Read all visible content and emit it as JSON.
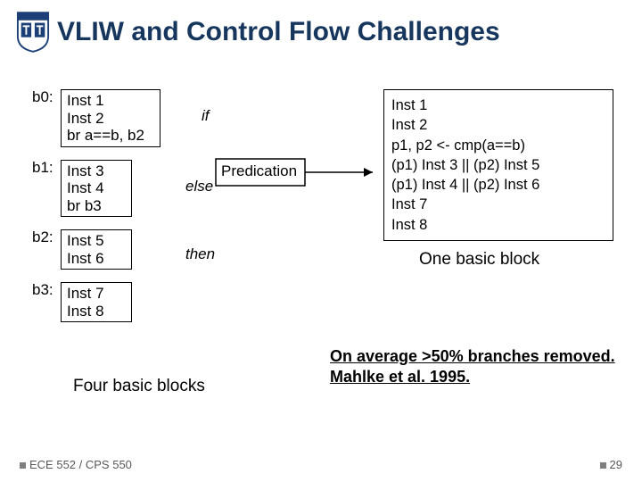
{
  "title": "VLIW and Control Flow Challenges",
  "blocks": {
    "b0": {
      "label": "b0:",
      "lines": [
        "Inst 1",
        "Inst 2",
        "br a==b, b2"
      ],
      "annot": "if"
    },
    "b1": {
      "label": "b1:",
      "lines": [
        "Inst 3",
        "Inst 4",
        "br b3"
      ],
      "annot": "else"
    },
    "b2": {
      "label": "b2:",
      "lines": [
        "Inst 5",
        "Inst 6"
      ],
      "annot": "then"
    },
    "b3": {
      "label": "b3:",
      "lines": [
        "Inst 7",
        "Inst 8"
      ]
    }
  },
  "diagram_label": "Predication",
  "big_box": {
    "lines": [
      "Inst 1",
      "Inst 2",
      "p1, p2 <- cmp(a==b)",
      "(p1) Inst 3    ||  (p2) Inst 5",
      "(p1) Inst 4    ||  (p2) Inst 6",
      "Inst 7",
      "Inst 8"
    ]
  },
  "caption_right": "One basic block",
  "caption_left": "Four basic blocks",
  "note": {
    "line1": "On average >50% branches removed.",
    "line2": "Mahlke et al. 1995."
  },
  "footer": {
    "course": "ECE 552 / CPS 550",
    "page": "29"
  }
}
